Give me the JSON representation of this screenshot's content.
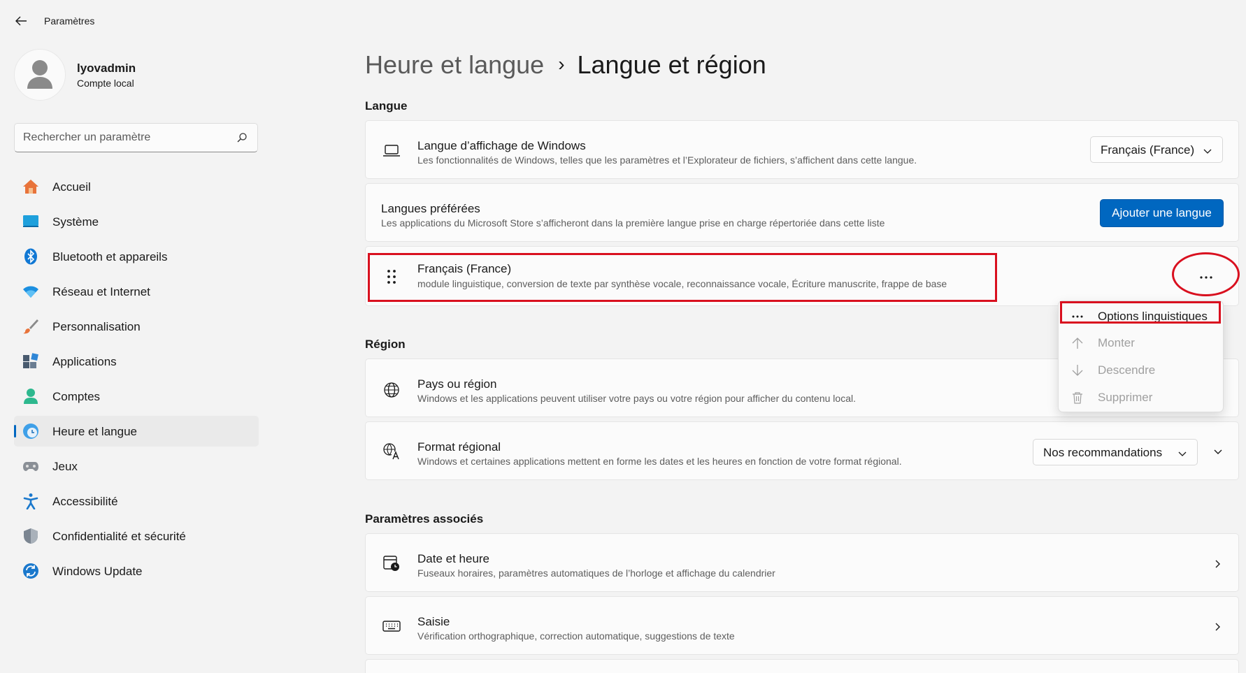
{
  "window": {
    "title": "Paramètres"
  },
  "profile": {
    "username": "lyovadmin",
    "account_type": "Compte local"
  },
  "search": {
    "placeholder": "Rechercher un paramètre"
  },
  "sidebar": {
    "items": [
      {
        "label": "Accueil",
        "icon": "home-icon"
      },
      {
        "label": "Système",
        "icon": "system-icon"
      },
      {
        "label": "Bluetooth et appareils",
        "icon": "bluetooth-icon"
      },
      {
        "label": "Réseau et Internet",
        "icon": "network-icon"
      },
      {
        "label": "Personnalisation",
        "icon": "brush-icon"
      },
      {
        "label": "Applications",
        "icon": "apps-icon"
      },
      {
        "label": "Comptes",
        "icon": "accounts-icon"
      },
      {
        "label": "Heure et langue",
        "icon": "time-language-icon",
        "active": true
      },
      {
        "label": "Jeux",
        "icon": "gamepad-icon"
      },
      {
        "label": "Accessibilité",
        "icon": "accessibility-icon"
      },
      {
        "label": "Confidentialité et sécurité",
        "icon": "shield-icon"
      },
      {
        "label": "Windows Update",
        "icon": "update-icon"
      }
    ]
  },
  "breadcrumb": {
    "parent": "Heure et langue",
    "separator": "›",
    "current": "Langue et région"
  },
  "sections": {
    "langue": "Langue",
    "region": "Région",
    "associes": "Paramètres associés"
  },
  "display_language": {
    "title": "Langue d’affichage de Windows",
    "description": "Les fonctionnalités de Windows, telles que les paramètres et l’Explorateur de fichiers, s’affichent dans cette langue.",
    "value": "Français (France)"
  },
  "preferred_languages": {
    "title": "Langues préférées",
    "description": "Les applications du Microsoft Store s’afficheront dans la première langue prise en charge répertoriée dans cette liste",
    "add_button": "Ajouter une langue"
  },
  "language_item": {
    "title": "Français (France)",
    "description": "module linguistique, conversion de texte par synthèse vocale, reconnaissance vocale, Écriture manuscrite, frappe de base",
    "more_label": "..."
  },
  "context_menu": {
    "items": [
      {
        "label": "Options linguistiques",
        "icon": "more-icon",
        "enabled": true
      },
      {
        "label": "Monter",
        "icon": "arrow-up-icon",
        "enabled": false
      },
      {
        "label": "Descendre",
        "icon": "arrow-down-icon",
        "enabled": false
      },
      {
        "label": "Supprimer",
        "icon": "trash-icon",
        "enabled": false
      }
    ]
  },
  "country": {
    "title": "Pays ou région",
    "description": "Windows et les applications peuvent utiliser votre pays ou votre région pour afficher du contenu local."
  },
  "regional_format": {
    "title": "Format régional",
    "description": "Windows et certaines applications mettent en forme les dates et les heures en fonction de votre format régional.",
    "value": "Nos recommandations"
  },
  "related": [
    {
      "title": "Date et heure",
      "description": "Fuseaux horaires, paramètres automatiques de l’horloge et affichage du calendrier",
      "icon": "calendar-clock-icon"
    },
    {
      "title": "Saisie",
      "description": "Vérification orthographique, correction automatique, suggestions de texte",
      "icon": "keyboard-icon"
    }
  ],
  "colors": {
    "accent": "#0067c0",
    "highlight": "#d9101f",
    "background": "#f3f3f3",
    "card": "#fbfbfb"
  }
}
